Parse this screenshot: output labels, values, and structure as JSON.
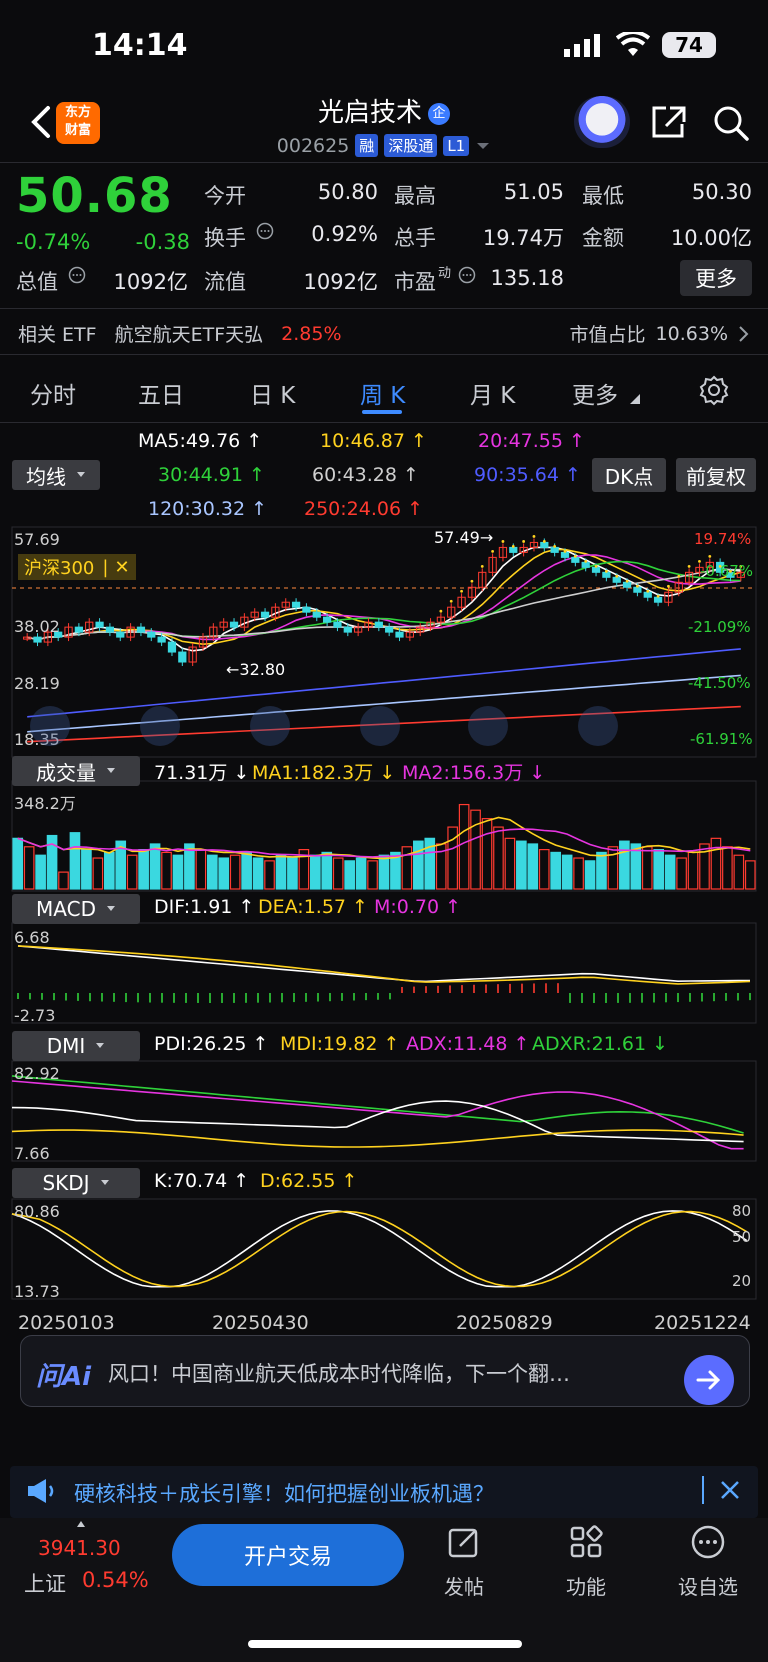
{
  "status": {
    "time": "14:14",
    "battery": "74"
  },
  "header": {
    "logo_line1": "东方",
    "logo_line2": "财富",
    "stock_name": "光启技术",
    "ent_badge": "企",
    "code": "002625",
    "tags": [
      "融",
      "深股通",
      "L1"
    ]
  },
  "quote": {
    "price": "50.68",
    "change_pct": "-0.74%",
    "change": "-0.38",
    "fields": [
      {
        "label": "今开",
        "value": "50.80",
        "color": "green"
      },
      {
        "label": "最高",
        "value": "51.05",
        "color": "green"
      },
      {
        "label": "最低",
        "value": "50.30",
        "color": "green"
      },
      {
        "label": "换手",
        "value": "0.92%",
        "color": "normal"
      },
      {
        "label": "总手",
        "value": "19.74万",
        "color": "normal"
      },
      {
        "label": "金额",
        "value": "10.00亿",
        "color": "normal"
      },
      {
        "label": "总值",
        "value": "1092亿",
        "color": "normal"
      },
      {
        "label": "流值",
        "value": "1092亿",
        "color": "normal"
      },
      {
        "label": "市盈",
        "value": "135.18",
        "color": "normal",
        "sup": "动"
      }
    ],
    "more": "更多"
  },
  "etf": {
    "label": "相关 ETF",
    "name": "航空航天ETF天弘",
    "pct": "2.85%",
    "share_label": "市值占比",
    "share": "10.63%"
  },
  "tabs": [
    {
      "label": "分时",
      "active": false
    },
    {
      "label": "五日",
      "active": false
    },
    {
      "label": "日 K",
      "active": false
    },
    {
      "label": "周 K",
      "active": true
    },
    {
      "label": "月 K",
      "active": false
    },
    {
      "label": "更多",
      "active": false
    }
  ],
  "ma": {
    "selector": "均线",
    "items": [
      {
        "text": "MA5:49.76",
        "color": "#ffffff"
      },
      {
        "text": "10:46.87",
        "color": "#ffd21f"
      },
      {
        "text": "20:47.55",
        "color": "#e635e0"
      },
      {
        "text": "30:44.91",
        "color": "#2fd13a"
      },
      {
        "text": "60:43.28",
        "color": "#cfcfcf"
      },
      {
        "text": "90:35.64",
        "color": "#4f5cff"
      },
      {
        "text": "120:30.32",
        "color": "#a9c6ff"
      },
      {
        "text": "250:24.06",
        "color": "#ff3b30"
      }
    ],
    "dk_button": "DK点",
    "adjust_button": "前复权"
  },
  "chart_data": [
    {
      "type": "candlestick",
      "name": "周K",
      "y_ticks": [
        "57.69",
        "47.86",
        "38.02",
        "28.19",
        "18.35"
      ],
      "ylim": [
        18.35,
        57.69
      ],
      "pct_ticks": [
        "19.74%",
        "-0.67%",
        "-21.09%",
        "-41.50%",
        "-61.91%"
      ],
      "annotations": [
        "57.49",
        "32.80"
      ],
      "overlay_label": "沪深300",
      "ohlc_trend": [
        38,
        37,
        39,
        38,
        40,
        39,
        41,
        40,
        39,
        38,
        40,
        39,
        38,
        37,
        35,
        33,
        36,
        38,
        40,
        41,
        40,
        42,
        43,
        42,
        44,
        45,
        44,
        43,
        42,
        41,
        40,
        39,
        40,
        41,
        40,
        39,
        38,
        39,
        40,
        41,
        42,
        44,
        46,
        48,
        51,
        54,
        56,
        55,
        56,
        57,
        56,
        55,
        54,
        53,
        52,
        51,
        50,
        49,
        48,
        47,
        46,
        45,
        47,
        49,
        51,
        52,
        53,
        51,
        50,
        51
      ],
      "ma_lines": {
        "MA5": 49.76,
        "MA10": 46.87,
        "MA20": 47.55,
        "MA30": 44.91,
        "MA60": 43.28,
        "MA90": 35.64,
        "MA120": 30.32,
        "MA250": 24.06
      }
    },
    {
      "type": "bar",
      "name": "成交量",
      "selector": "成交量",
      "labels": [
        {
          "text": "71.31万",
          "color": "#ffffff"
        },
        {
          "text": "MA1:182.3万",
          "color": "#ffd21f"
        },
        {
          "text": "MA2:156.3万",
          "color": "#e635e0"
        }
      ],
      "y_top": "348.2万",
      "values": [
        180,
        150,
        120,
        190,
        60,
        200,
        140,
        110,
        130,
        170,
        120,
        140,
        160,
        130,
        120,
        160,
        140,
        120,
        110,
        120,
        130,
        110,
        100,
        120,
        110,
        140,
        120,
        130,
        110,
        100,
        110,
        100,
        120,
        130,
        150,
        170,
        180,
        160,
        220,
        300,
        280,
        250,
        220,
        180,
        170,
        160,
        140,
        130,
        120,
        110,
        100,
        130,
        150,
        170,
        160,
        150,
        140,
        120,
        110,
        130,
        160,
        180,
        150,
        120,
        100
      ],
      "colors_hint": "alternating cyan (down) and red (up)"
    },
    {
      "type": "line",
      "name": "MACD",
      "selector": "MACD",
      "labels": [
        {
          "text": "DIF:1.91",
          "color": "#ffffff"
        },
        {
          "text": "DEA:1.57",
          "color": "#ffd21f"
        },
        {
          "text": "M:0.70",
          "color": "#e635e0"
        }
      ],
      "y_ticks": [
        "6.68",
        "-2.73"
      ]
    },
    {
      "type": "line",
      "name": "DMI",
      "selector": "DMI",
      "labels": [
        {
          "text": "PDI:26.25",
          "color": "#ffffff"
        },
        {
          "text": "MDI:19.82",
          "color": "#ffd21f"
        },
        {
          "text": "ADX:11.48",
          "color": "#e635e0"
        },
        {
          "text": "ADXR:21.61",
          "color": "#2fd13a"
        }
      ],
      "y_ticks": [
        "82.92",
        "7.66"
      ]
    },
    {
      "type": "line",
      "name": "SKDJ",
      "selector": "SKDJ",
      "labels": [
        {
          "text": "K:70.74",
          "color": "#ffffff"
        },
        {
          "text": "D:62.55",
          "color": "#ffd21f"
        }
      ],
      "y_ticks": [
        "80.86",
        "13.73"
      ],
      "right_ticks": [
        "80",
        "50",
        "20"
      ],
      "x_labels": [
        "20250103",
        "20250430",
        "20250829",
        "20251224"
      ]
    }
  ],
  "ai": {
    "logo": "问Ai",
    "text": "风口！中国商业航天低成本时代降临，下一个翻…"
  },
  "notice": {
    "text": "硬核科技＋成长引擎！如何把握创业板机遇？"
  },
  "footer": {
    "index_value": "3941.30",
    "index_name": "上证",
    "index_pct": "0.54%",
    "trade_button": "开户交易",
    "items": [
      "发帖",
      "功能",
      "设自选"
    ]
  }
}
